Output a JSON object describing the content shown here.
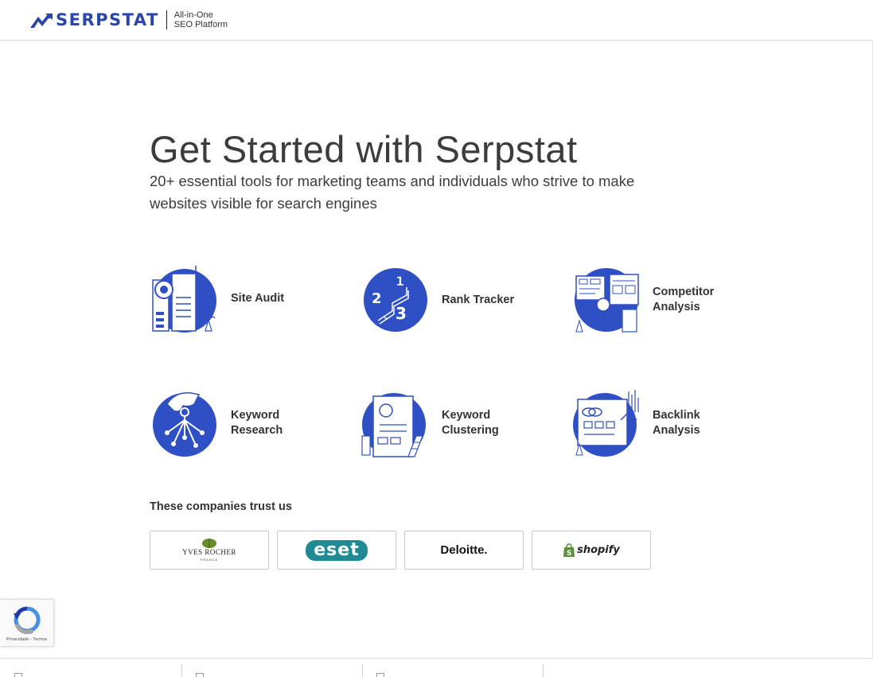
{
  "header": {
    "logo_text": "SERPSTAT",
    "tagline_line1": "All-in-One",
    "tagline_line2": "SEO Platform"
  },
  "main": {
    "title": "Get Started with Serpstat",
    "subtitle": "20+ essential tools for marketing teams and individuals who strive to make websites visible for search engines",
    "tools": [
      {
        "label": "Site Audit",
        "icon": "site-audit-icon"
      },
      {
        "label": "Rank Tracker",
        "icon": "rank-tracker-icon"
      },
      {
        "label": "Competitor Analysis",
        "icon": "competitor-analysis-icon"
      },
      {
        "label": "Keyword Research",
        "icon": "keyword-research-icon"
      },
      {
        "label": "Keyword Clustering",
        "icon": "keyword-clustering-icon"
      },
      {
        "label": "Backlink Analysis",
        "icon": "backlink-analysis-icon"
      }
    ]
  },
  "trust": {
    "title": "These companies trust us",
    "brands": [
      {
        "name": "YVES ROCHER",
        "sub": "FRANCE"
      },
      {
        "name": "eset"
      },
      {
        "name": "Deloitte."
      },
      {
        "name": "shopify"
      }
    ]
  },
  "recaptcha": {
    "links": "Privacidade - Termos"
  },
  "colors": {
    "brand_blue": "#2a46a8",
    "icon_blue": "#2f4fc4",
    "eset_teal": "#1f8a93",
    "shopify_green": "#5e8e3e",
    "text": "#333333"
  }
}
